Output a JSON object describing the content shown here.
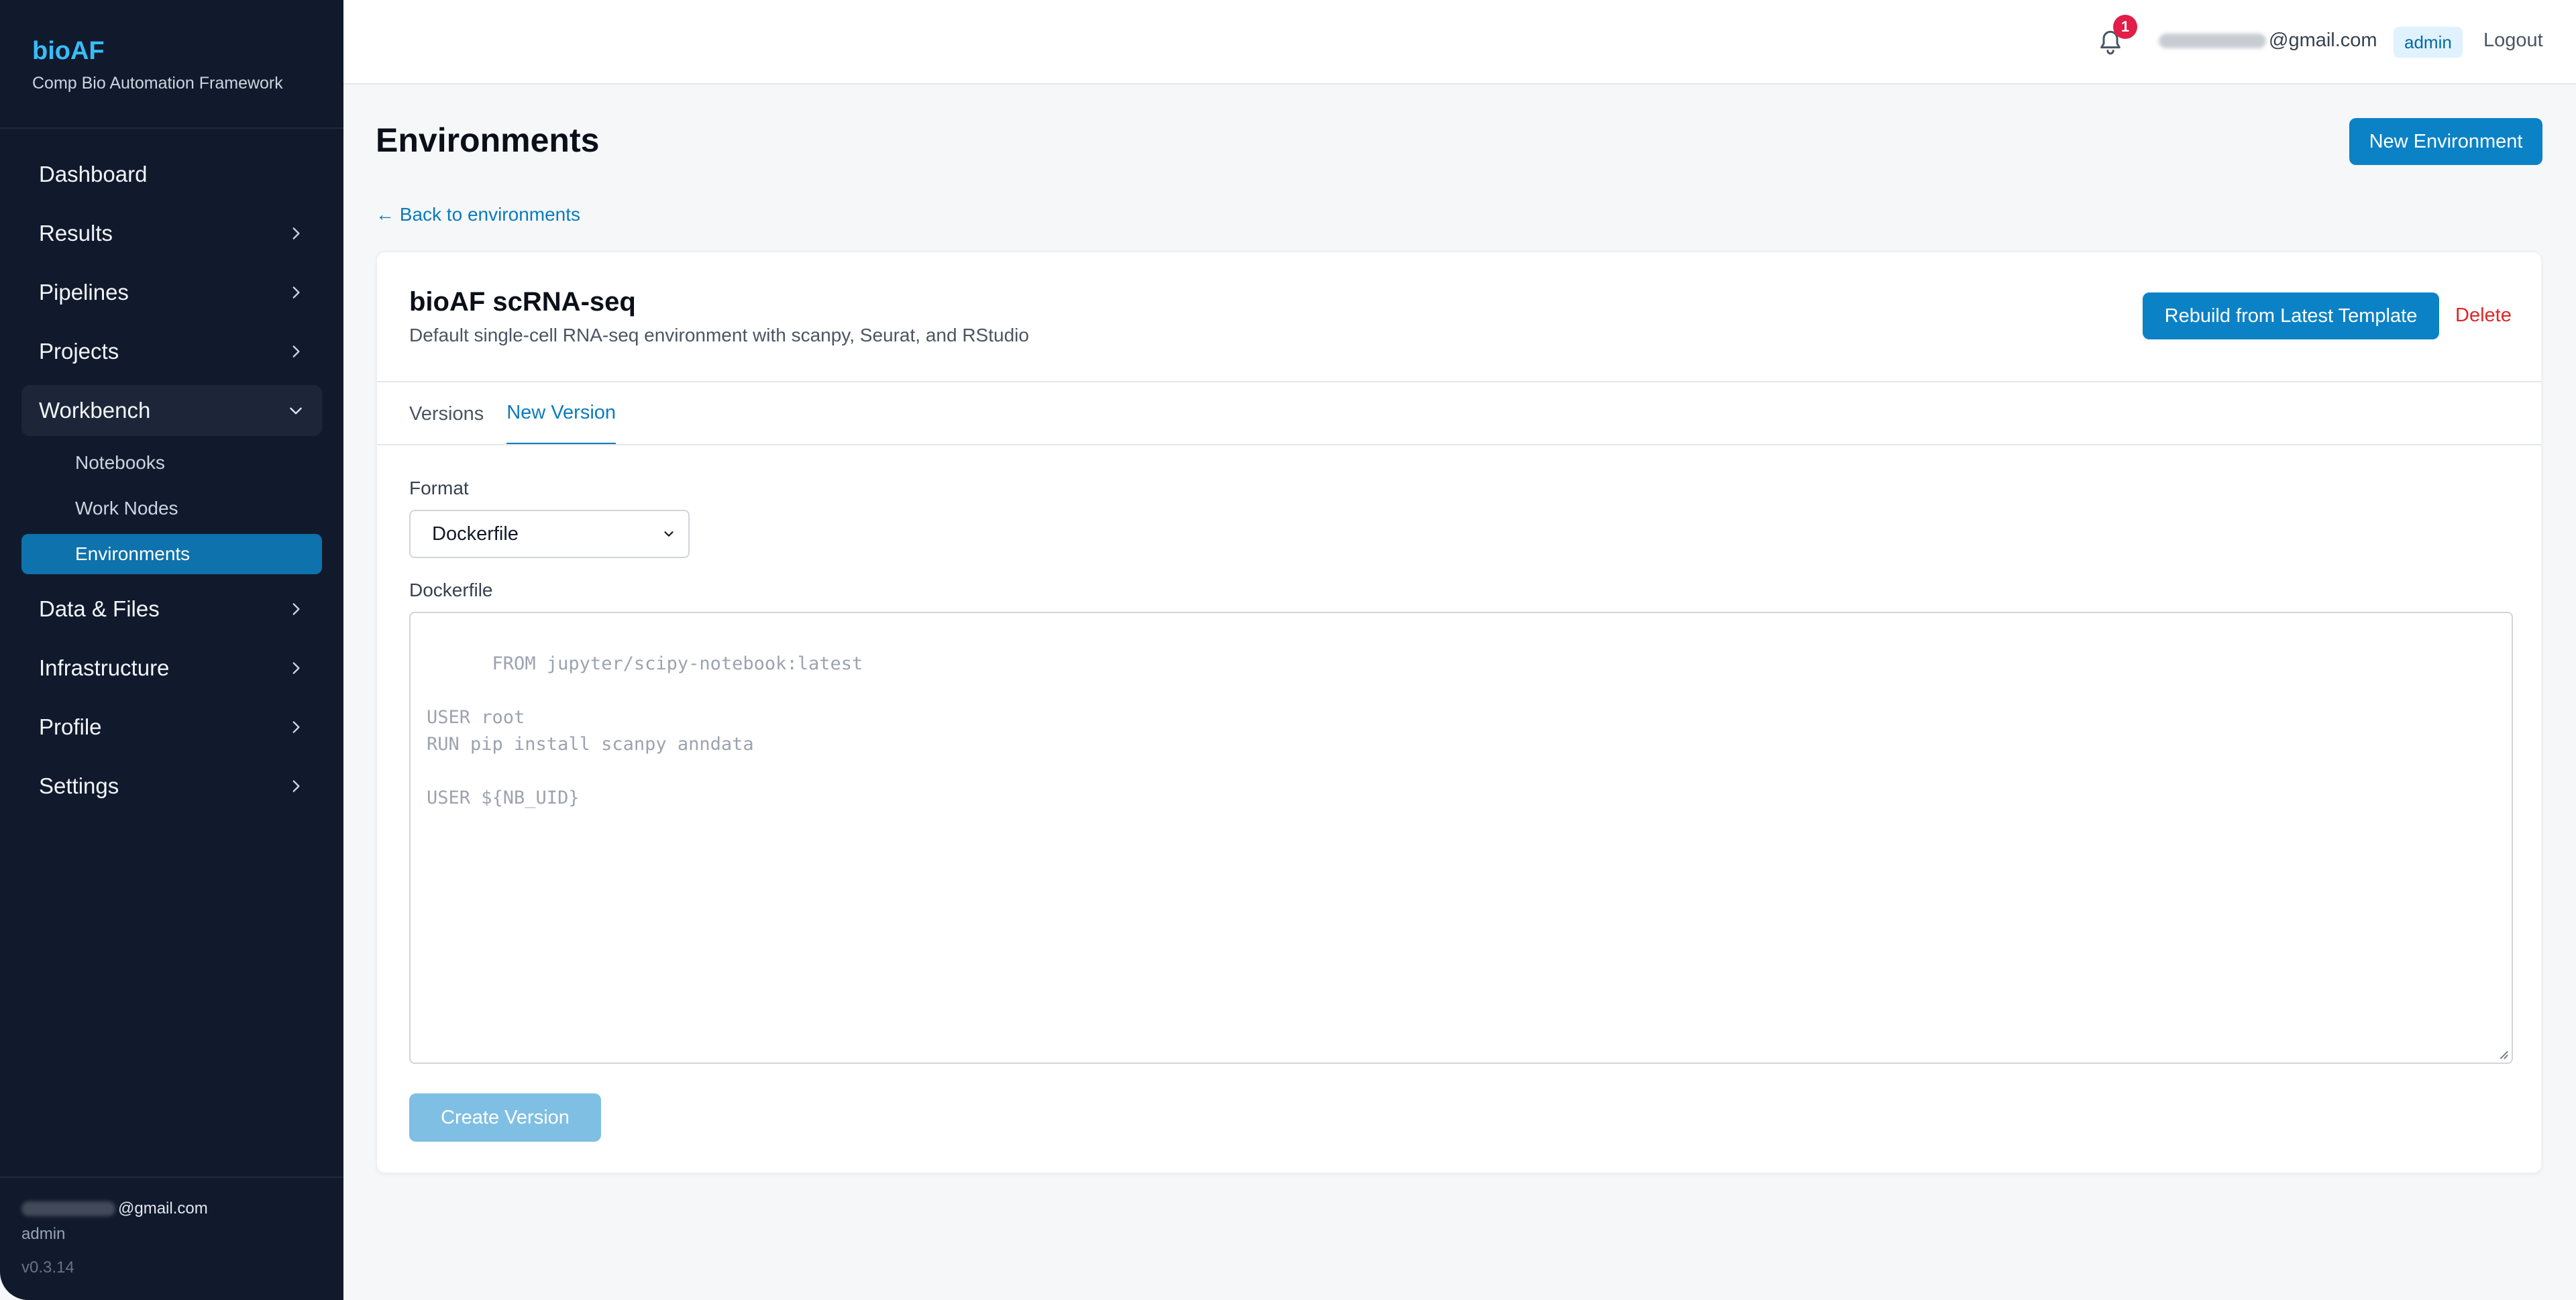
{
  "app": {
    "title": "bioAF",
    "subtitle": "Comp Bio Automation Framework"
  },
  "sidebar": {
    "items": [
      {
        "label": "Dashboard",
        "has_chevron": false
      },
      {
        "label": "Results",
        "has_chevron": true
      },
      {
        "label": "Pipelines",
        "has_chevron": true
      },
      {
        "label": "Projects",
        "has_chevron": true
      },
      {
        "label": "Workbench",
        "has_chevron": true,
        "expanded": true
      },
      {
        "label": "Data & Files",
        "has_chevron": true
      },
      {
        "label": "Infrastructure",
        "has_chevron": true
      },
      {
        "label": "Profile",
        "has_chevron": true
      },
      {
        "label": "Settings",
        "has_chevron": true
      }
    ],
    "workbench_children": [
      {
        "label": "Notebooks"
      },
      {
        "label": "Work Nodes"
      },
      {
        "label": "Environments",
        "active": true
      }
    ],
    "footer": {
      "email_domain": "@gmail.com",
      "role": "admin",
      "version": "v0.3.14"
    }
  },
  "topbar": {
    "notification_count": "1",
    "email_domain": "@gmail.com",
    "role_badge": "admin",
    "logout_label": "Logout"
  },
  "page": {
    "title": "Environments",
    "new_button": "New Environment",
    "back_link": "← Back to environments"
  },
  "environment": {
    "name": "bioAF scRNA-seq",
    "description": "Default single-cell RNA-seq environment with scanpy, Seurat, and RStudio",
    "rebuild_button": "Rebuild from Latest Template",
    "delete_button": "Delete",
    "tabs": [
      {
        "label": "Versions",
        "active": false
      },
      {
        "label": "New Version",
        "active": true
      }
    ],
    "form": {
      "format_label": "Format",
      "format_value": "Dockerfile",
      "dockerfile_label": "Dockerfile",
      "dockerfile_placeholder": "FROM jupyter/scipy-notebook:latest\n\nUSER root\nRUN pip install scanpy anndata\n\nUSER ${NB_UID}",
      "submit_label": "Create Version"
    }
  },
  "colors": {
    "sidebar_bg": "#111a2c",
    "brand": "#38bdf8",
    "accent": "#0b82c6",
    "active_nav": "#0e72ad",
    "danger": "#dc2626",
    "badge": "#e11d48"
  }
}
